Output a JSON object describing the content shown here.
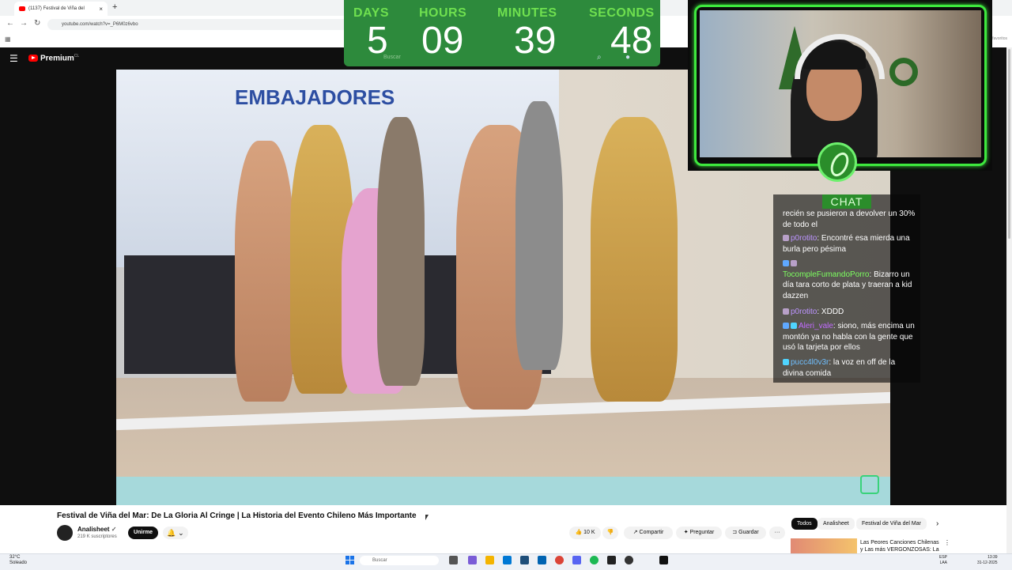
{
  "browser": {
    "tab_title": "(1137) Festival de Viña del",
    "new_tab_symbol": "+",
    "close_symbol": "×",
    "url": "youtube.com/watch?v=_P6M0z6vbo",
    "favorites_label": "favoritos"
  },
  "youtube": {
    "brand": "Premium",
    "region": "CL"
  },
  "countdown": {
    "labels": [
      "DAYS",
      "HOURS",
      "MINUTES",
      "SECONDS"
    ],
    "values": [
      "5",
      "09",
      "39",
      "48"
    ],
    "search_placeholder": "Buscar"
  },
  "chat": {
    "title": "CHAT",
    "messages": [
      {
        "user": "",
        "text": "recién se pusieron a devolver un 30% de todo el"
      },
      {
        "user": "p0rotito",
        "text": "Encontré esa mierda una burla pero pésima"
      },
      {
        "user": "TocompleFumandoPorro",
        "text": "Bizarro un día tara corto de plata y traeran a kid dazzen"
      },
      {
        "user": "p0rotito",
        "text": "XDDD"
      },
      {
        "user": "Aleri_vale",
        "text": "siono, más encima un montón ya no habla con la gente que usó la tarjeta por ellos"
      },
      {
        "user": "pucc4l0v3r",
        "text": "la voz en off de la divina comida"
      }
    ]
  },
  "video": {
    "title": "Festival de Viña del Mar: De La Gloria Al Cringe | La Historia del Evento Chileno Más Importante",
    "channel": "Analisheet",
    "subscribers": "219 K suscriptores",
    "join_label": "Unirme",
    "bell_symbol": "🔔",
    "likes": "10 K",
    "share_label": "Compartir",
    "ask_label": "Preguntar",
    "save_label": "Guardar",
    "more_symbol": "···"
  },
  "chips": [
    "Todos",
    "Analisheet",
    "Festival de Viña del Mar"
  ],
  "recommendation": {
    "title": "Las Peores Canciones Chilenas y Las más VERGONZOSAS: La"
  },
  "taskbar": {
    "temperature": "32°C",
    "condition": "Soleado",
    "search_placeholder": "Buscar",
    "lang1": "ESP",
    "lang2": "LAA",
    "time": "13:39",
    "date": "31-12-2025"
  },
  "colors": {
    "overlay_green": "#3ee83e",
    "countdown_bg": "#2d8a3c",
    "youtube_red": "#ff0000"
  }
}
